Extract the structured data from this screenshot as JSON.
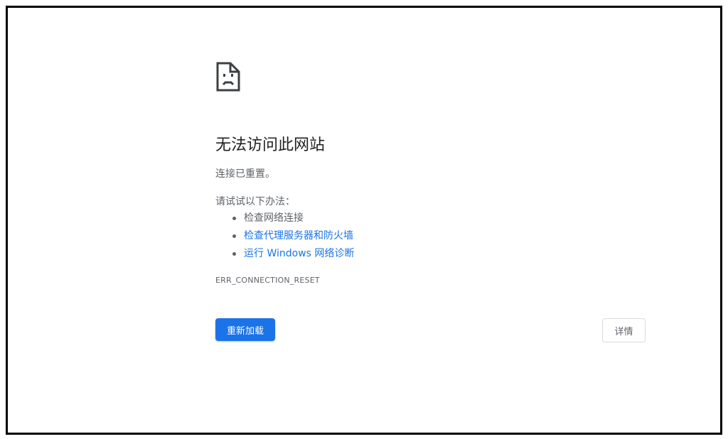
{
  "error_page": {
    "icon": "sad-page-icon",
    "title": "无法访问此网站",
    "subtitle": "连接已重置。",
    "suggestions_heading": "请试试以下办法：",
    "suggestions": [
      {
        "label": "检查网络连接",
        "is_link": false
      },
      {
        "label": "检查代理服务器和防火墙",
        "is_link": true
      },
      {
        "label": "运行 Windows 网络诊断",
        "is_link": true
      }
    ],
    "error_code": "ERR_CONNECTION_RESET"
  },
  "buttons": {
    "reload_label": "重新加载",
    "details_label": "详情"
  },
  "colors": {
    "accent": "#1a73e8",
    "text_primary": "#202124",
    "text_secondary": "#5f6368",
    "border": "#dadce0"
  }
}
